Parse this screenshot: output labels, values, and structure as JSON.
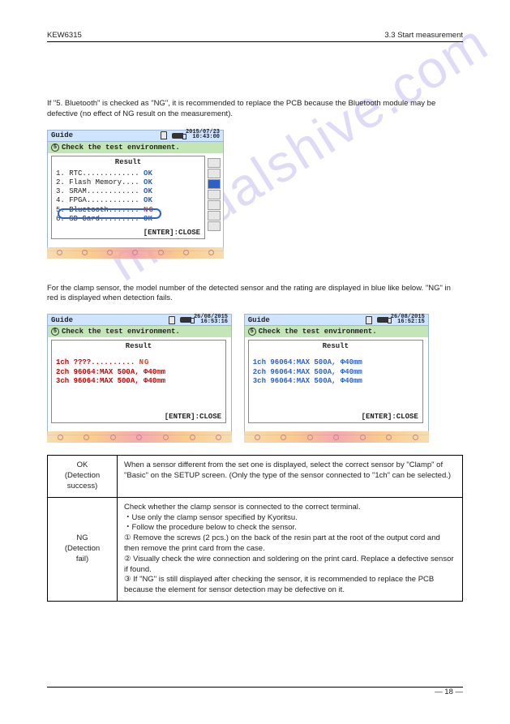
{
  "header": {
    "model": "KEW6315",
    "page_no": "3.3 Start measurement"
  },
  "intro1": "If \"5. Bluetooth\" is checked as \"NG\", it is recommended to replace the PCB because the Bluetooth module may be defective (no effect of NG result on the measurement).",
  "intro2": "For the clamp sensor, the model number of the detected sensor and the rating are displayed in blue like below. \"NG\" in red is displayed when detection fails.",
  "device1": {
    "title": "Guide",
    "date1": "2015/07/23",
    "date2": "10:43:00",
    "sub_num": "5",
    "sub": "Check the test environment.",
    "result": "Result",
    "rows": [
      {
        "n": "1",
        "label": "RTC",
        "status": "OK"
      },
      {
        "n": "2",
        "label": "Flash Memory",
        "status": "OK"
      },
      {
        "n": "3",
        "label": "SRAM",
        "status": "OK"
      },
      {
        "n": "4",
        "label": "FPGA",
        "status": "OK"
      },
      {
        "n": "5",
        "label": "Bluetooth",
        "status": "NG"
      },
      {
        "n": "6",
        "label": "SD Card",
        "status": "OK"
      }
    ],
    "enter": "[ENTER]:CLOSE"
  },
  "device2": {
    "title": "Guide",
    "date1": "26/08/2015",
    "date2": "16:53:16",
    "sub_num": "5",
    "sub": "Check the test environment.",
    "result": "Result",
    "rows": [
      {
        "ch": "1ch",
        "text": "????..........",
        "status": "NG",
        "cls": "red"
      },
      {
        "ch": "2ch",
        "text": "96064:MAX 500A,",
        "diam": "Φ40mm",
        "cls": "red"
      },
      {
        "ch": "3ch",
        "text": "96064:MAX 500A,",
        "diam": "Φ40mm",
        "cls": "red"
      }
    ],
    "enter": "[ENTER]:CLOSE"
  },
  "device3": {
    "title": "Guide",
    "date1": "26/08/2015",
    "date2": "16:52:15",
    "sub_num": "5",
    "sub": "Check the test environment.",
    "result": "Result",
    "rows": [
      {
        "ch": "1ch",
        "text": "96064:MAX 500A,",
        "diam": "Φ40mm",
        "cls": "blue"
      },
      {
        "ch": "2ch",
        "text": "96064:MAX 500A,",
        "diam": "Φ40mm",
        "cls": "blue"
      },
      {
        "ch": "3ch",
        "text": "96064:MAX 500A,",
        "diam": "Φ40mm",
        "cls": "blue"
      }
    ],
    "enter": "[ENTER]:CLOSE"
  },
  "table": {
    "r1c1": "OK\n(Detection\nsuccess)",
    "r1c2": "When a sensor different from the set one is displayed, select the correct sensor by \"Clamp\" of \"Basic\" on the SETUP screen. (Only the type of the sensor connected to \"1ch\" can be selected.)",
    "r2c1": "NG\n(Detection\nfail)",
    "r2c2": "Check whether the clamp sensor is connected to the correct terminal.\n・Use only the clamp sensor specified by Kyoritsu.\n・Follow the procedure below to check the sensor.\n① Remove the screws (2 pcs.) on the back of the resin part at the root of the output cord and then remove the print card from the case.\n② Visually check the wire connection and soldering on the print card. Replace a defective sensor if found.\n③ If \"NG\" is still displayed after checking the sensor, it is recommended to replace the PCB because the element for sensor detection may be defective on it."
  },
  "footer": {
    "left": "",
    "right": "— 18 —"
  },
  "watermark": "manualshive.com"
}
